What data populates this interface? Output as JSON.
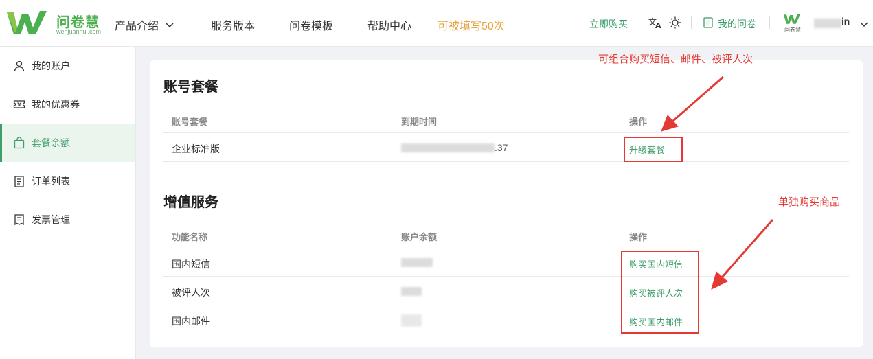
{
  "brand": {
    "name": "问卷慧",
    "domain": "wenjuanhui.com",
    "color": "#4caf50"
  },
  "nav": {
    "items": [
      {
        "label": "产品介绍",
        "has_dropdown": true
      },
      {
        "label": "服务版本"
      },
      {
        "label": "问卷模板"
      },
      {
        "label": "帮助中心"
      }
    ],
    "promo": "可被填写50次"
  },
  "header_right": {
    "buy_now": "立即购买",
    "translate_icon": "translate-icon",
    "theme_icon": "sun-icon",
    "my_survey": "我的问卷",
    "avatar_logo_text": "问卷慧",
    "user_name_suffix": "in"
  },
  "sidebar": {
    "items": [
      {
        "label": "我的账户",
        "icon": "user-icon",
        "active": false
      },
      {
        "label": "我的优惠券",
        "icon": "coupon-icon",
        "active": false
      },
      {
        "label": "套餐余额",
        "icon": "bag-icon",
        "active": true
      },
      {
        "label": "订单列表",
        "icon": "list-icon",
        "active": false
      },
      {
        "label": "发票管理",
        "icon": "invoice-icon",
        "active": false
      }
    ]
  },
  "package": {
    "title": "账号套餐",
    "columns": [
      "账号套餐",
      "到期时间",
      "操作"
    ],
    "rows": [
      {
        "name": "企业标准版",
        "expire_suffix": ".37",
        "action": "升级套餐"
      }
    ]
  },
  "value_added": {
    "title": "增值服务",
    "columns": [
      "功能名称",
      "账户余额",
      "操作"
    ],
    "rows": [
      {
        "name": "国内短信",
        "action": "购买国内短信"
      },
      {
        "name": "被评人次",
        "action": "购买被评人次"
      },
      {
        "name": "国内邮件",
        "action": "购买国内邮件"
      }
    ]
  },
  "annotations": {
    "top": "可组合购买短信、邮件、被评人次",
    "right": "单独购买商品"
  },
  "colors": {
    "accent": "#3f9d6a",
    "promo": "#e6a23c",
    "annotation": "#e53935"
  }
}
